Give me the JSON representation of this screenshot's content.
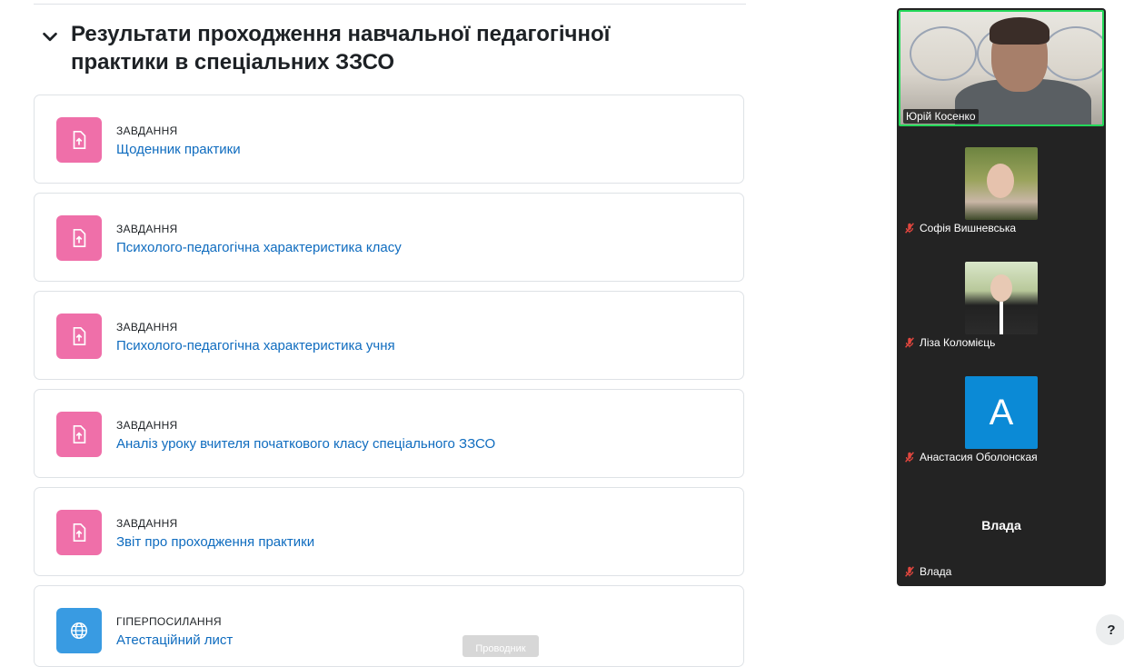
{
  "section": {
    "title": "Результати проходження навчальної педагогічної практики в спеціальних ЗЗСО"
  },
  "activities": [
    {
      "type": "ЗАВДАННЯ",
      "title": "Щоденник практики",
      "icon": "assignment-upload-icon",
      "color": "#ef6fa9"
    },
    {
      "type": "ЗАВДАННЯ",
      "title": "Психолого-педагогічна характеристика класу",
      "icon": "assignment-upload-icon",
      "color": "#ef6fa9"
    },
    {
      "type": "ЗАВДАННЯ",
      "title": "Психолого-педагогічна характеристика учня",
      "icon": "assignment-upload-icon",
      "color": "#ef6fa9"
    },
    {
      "type": "ЗАВДАННЯ",
      "title": "Аналіз уроку вчителя початкового класу спеціального ЗЗСО",
      "icon": "assignment-upload-icon",
      "color": "#ef6fa9"
    },
    {
      "type": "ЗАВДАННЯ",
      "title": "Звіт про проходження практики",
      "icon": "assignment-upload-icon",
      "color": "#ef6fa9"
    },
    {
      "type": "ГІПЕРПОСИЛАННЯ",
      "title": "Атестаційний лист",
      "icon": "globe-icon",
      "color": "#399be2"
    }
  ],
  "video_call": {
    "active_speaker": {
      "name": "Юрій Косенко"
    },
    "participants": [
      {
        "name": "Софія Вишневська",
        "muted": true
      },
      {
        "name": "Ліза Коломієць",
        "muted": true
      },
      {
        "name": "Анастасия Оболонская",
        "muted": true,
        "avatar_letter": "A"
      },
      {
        "name": "Влада",
        "muted": true,
        "center_label": "Влада"
      }
    ],
    "accent_color": "#23d959"
  },
  "overlay": {
    "presenter_label": "Проводник"
  },
  "help": {
    "label": "?"
  }
}
